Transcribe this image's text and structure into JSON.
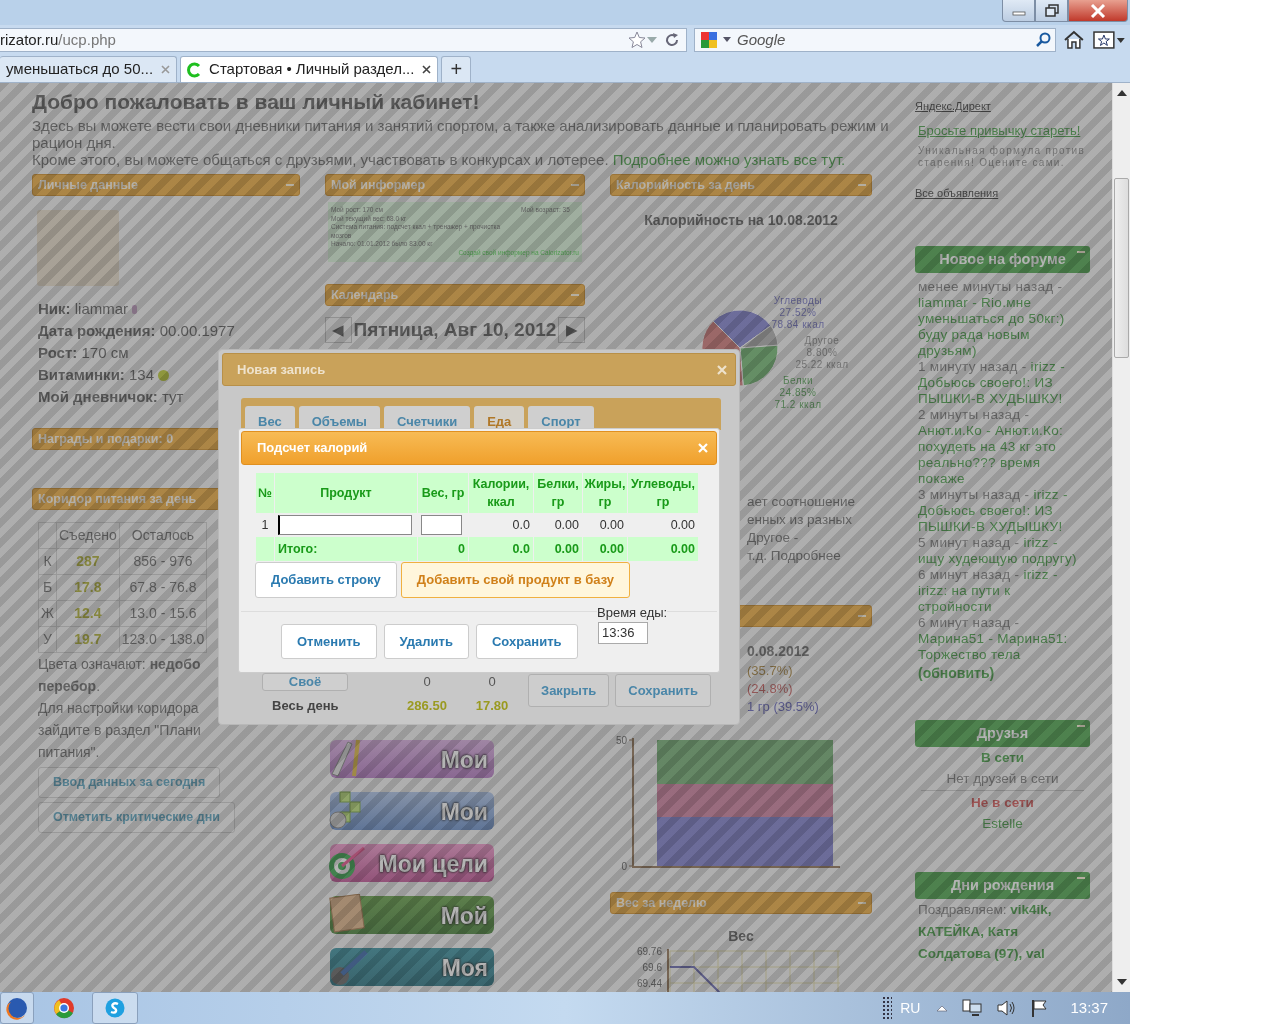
{
  "browser": {
    "tabs": [
      {
        "label": "уменьшаться до 50...",
        "selected": false
      },
      {
        "label": "Стартовая • Личный раздел...",
        "selected": true
      }
    ],
    "new_tab": "+",
    "url_host": "rizator.ru",
    "url_path": "/ucp.php",
    "search_placeholder": "Google"
  },
  "page": {
    "title": "Добро пожаловать в ваш личный кабинет!",
    "intro": "Здесь вы можете вести свои дневники питания и занятий спортом, а также анализировать данные и планировать режим и рацион дня.",
    "intro2": "Кроме этого, вы можете общаться с друзьями, участвовать в конкурсах и лотерее.",
    "intro_link": "Подробнее можно узнать все тут.",
    "personal": {
      "title": "Личные данные",
      "fields": [
        "**Ник:** liammar",
        "**Дата рождения:** 00.00.1977",
        "**Рост:** 170 см",
        "**Витаминки:** 134",
        "**Мой дневничок:** тут"
      ]
    },
    "awards": {
      "title": "Награды и подарки: 0"
    },
    "corridor": {
      "title": "Коридор питания за день",
      "columns": [
        "Съедено",
        "Осталось"
      ],
      "rows": [
        {
          "nutrient": "К",
          "eaten": "287",
          "left": "856 - 976"
        },
        {
          "nutrient": "Б",
          "eaten": "17.8",
          "left": "67.8 - 76.8"
        },
        {
          "nutrient": "Ж",
          "eaten": "12.4",
          "left": "13.0 - 15.6"
        },
        {
          "nutrient": "У",
          "eaten": "19.7",
          "left": "123.0 - 138.0"
        }
      ],
      "legend": [
        "Цвета означают: **недобо**",
        "**перебор**."
      ],
      "note": [
        "Для настройки коридора",
        "зайдите в раздел \"Плани",
        "питания\"."
      ],
      "buttons": [
        "Ввод данных за сегодня",
        "Отметить критические дни"
      ]
    },
    "informer": {
      "title": "Мой информер",
      "lines": [
        [
          "Мой рост: 170 см",
          "Мой возраст: 35"
        ],
        [
          "Мой текущий вес: 68.0 кг"
        ],
        [
          "Система питания: подсчет ккал + тренажер + прочистка мозгов"
        ],
        [
          "Начало: 01.01.2012 было 83.00 кг"
        ]
      ],
      "link": "Создай свой информер на Calorizator.ru"
    },
    "calendar": {
      "title": "Календарь",
      "prev": "◀",
      "date": "Пятница, Авг 10, 2012",
      "next": "▶"
    },
    "menu_banners": [
      "Мои",
      "Мои",
      "Мои цели",
      "Мой",
      "Моя"
    ],
    "calories": {
      "title": "Калорийность за день",
      "subtitle": "Калорийность на 10.08.2012",
      "pie_labels": [
        {
          "name": "Углеводы",
          "percent": "27.52%",
          "kcal": "78.84 ккал"
        },
        {
          "name": "Другое",
          "percent": "8.80%",
          "kcal": "25.22 ккал"
        },
        {
          "name": "Белки",
          "percent": "24.85%",
          "kcal": "71.2 ккал"
        }
      ],
      "description": [
        "ает соотношение",
        "енных из разных",
        "Другое -",
        "т.д. Подробнее"
      ]
    },
    "daily": {
      "date": "0.08.2012",
      "shares": [
        "(35.7%)",
        "(24.8%)",
        "1 гр (39.5%)"
      ],
      "yticks": [
        "50",
        "0"
      ]
    },
    "weekly": {
      "title": "Вес за неделю",
      "chart_title": "Вес",
      "yticks": [
        "69.76",
        "69.6",
        "69.44"
      ]
    },
    "ads": {
      "title": "Яндекс.Директ",
      "link": "Бросьте привычку стареть!",
      "text": "Уникальная формула против старения! Оцените сами.",
      "all": "Все объявления"
    },
    "forum": {
      "title": "Новое на форуме",
      "posts": [
        {
          "time": "менее минуты назад - ",
          "topic": "liammar - Rio.мне уменьшаться до 50кг:) буду рада новым друзьям)"
        },
        {
          "time": "1 минуту назад - ",
          "topic": "irizz - Добьюсь своего!: ИЗ ПЫШКИ-В ХУДЫШКУ!"
        },
        {
          "time": "2 минуты назад - ",
          "topic": "Анют.и.Ко - Анют.и.Ко: похудеть на 43 кг это реально??? время покаже"
        },
        {
          "time": "3 минуты назад - ",
          "topic": "irizz - Добьюсь своего!: ИЗ ПЫШКИ-В ХУДЫШКУ!"
        },
        {
          "time": "5 минут назад - ",
          "topic": "irizz - ищу худеющую подругу)"
        },
        {
          "time": "6 минут назад - ",
          "topic": "irizz - irizz: на пути к стройности"
        },
        {
          "time": "6 минут назад - ",
          "topic": "Марина51 - Марина51: Торжество тела"
        }
      ],
      "refresh": "(обновить)"
    },
    "friends": {
      "title": "Друзья",
      "online_heading": "В сети",
      "online_empty": "Нет друзей в сети",
      "offline_heading": "Не в сети",
      "offline": [
        "Estelle"
      ]
    },
    "birthdays": {
      "title": "Дни рождения",
      "prefix": "Поздравляем: ",
      "names": "vik4ik, КАТЕЙКА, Катя Солдатова (97), val"
    }
  },
  "entry_dialog": {
    "title": "Новая запись",
    "tabs": [
      {
        "label": "Вес",
        "selected": false
      },
      {
        "label": "Объемы",
        "selected": false
      },
      {
        "label": "Счетчики",
        "selected": false
      },
      {
        "label": "Еда",
        "selected": true
      },
      {
        "label": "Спорт",
        "selected": false
      }
    ],
    "own_button": "Своё",
    "own_values": [
      "0",
      "0"
    ],
    "day_label": "Весь день",
    "day_values": [
      "286.50",
      "17.80"
    ],
    "buttons": [
      "Закрыть",
      "Сохранить"
    ]
  },
  "calc_dialog": {
    "title": "Подсчет калорий",
    "columns": [
      "№",
      "Продукт",
      "Вес, гр",
      "Калории, ккал",
      "Белки, гр",
      "Жиры, гр",
      "Углеводы, гр"
    ],
    "rows": [
      {
        "number": "1",
        "calories": "0.0",
        "protein": "0.00",
        "fat": "0.00",
        "carbs": "0.00"
      }
    ],
    "total": {
      "label": "Итого:",
      "weight": "0",
      "calories": "0.0",
      "protein": "0.00",
      "fat": "0.00",
      "carbs": "0.00"
    },
    "add_row": "Добавить строку",
    "add_product": "Добавить свой продукт в базу",
    "buttons": [
      "Отменить",
      "Удалить",
      "Сохранить"
    ],
    "time_label": "Время еды:",
    "time_value": "13:36"
  },
  "taskbar": {
    "language": "RU",
    "clock": "13:37"
  }
}
